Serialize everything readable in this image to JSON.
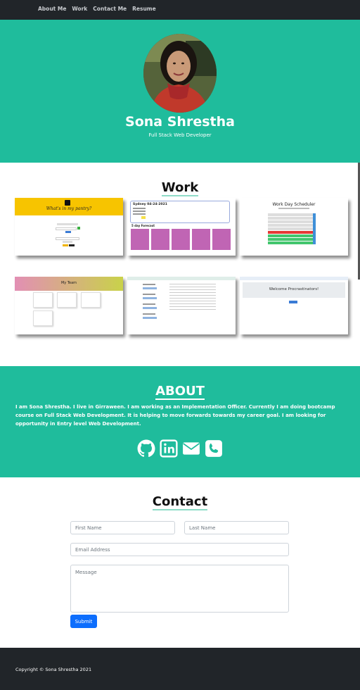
{
  "nav": {
    "items": [
      "About Me",
      "Work",
      "Contact Me",
      "Resume"
    ]
  },
  "hero": {
    "name": "Sona Shrestha",
    "role": "Full Stack Web Developer"
  },
  "work": {
    "title": "Work",
    "projects": [
      {
        "heading": "What's in my pantry?"
      },
      {
        "heading": "Sydney 04-24-2021",
        "subheading": "5 day Forecast"
      },
      {
        "heading": "Work Day Scheduler"
      },
      {
        "heading": "My Team"
      },
      {
        "heading": ""
      },
      {
        "heading": "Welcome Procrastinators!"
      }
    ]
  },
  "about": {
    "title": "ABOUT",
    "text": "I am Sona Shrestha. I live in Girraween. I am working as an Implementation Officer. Currently I am doing bootcamp course on Full Stack Web Development. It is helping to move forwards towards my career goal. I am looking for opportunity in Entry level Web Development.",
    "icons": [
      "github-icon",
      "linkedin-icon",
      "envelope-icon",
      "phone-icon"
    ]
  },
  "contact": {
    "title": "Contact",
    "first_name_placeholder": "First Name",
    "last_name_placeholder": "Last Name",
    "email_placeholder": "Email Address",
    "message_placeholder": "Message",
    "submit_label": "Submit"
  },
  "footer": {
    "copyright": "Copyright © Sona Shrestha 2021"
  },
  "colors": {
    "accent": "#1fbc9c",
    "dark": "#212529",
    "primary": "#0d6efd"
  }
}
